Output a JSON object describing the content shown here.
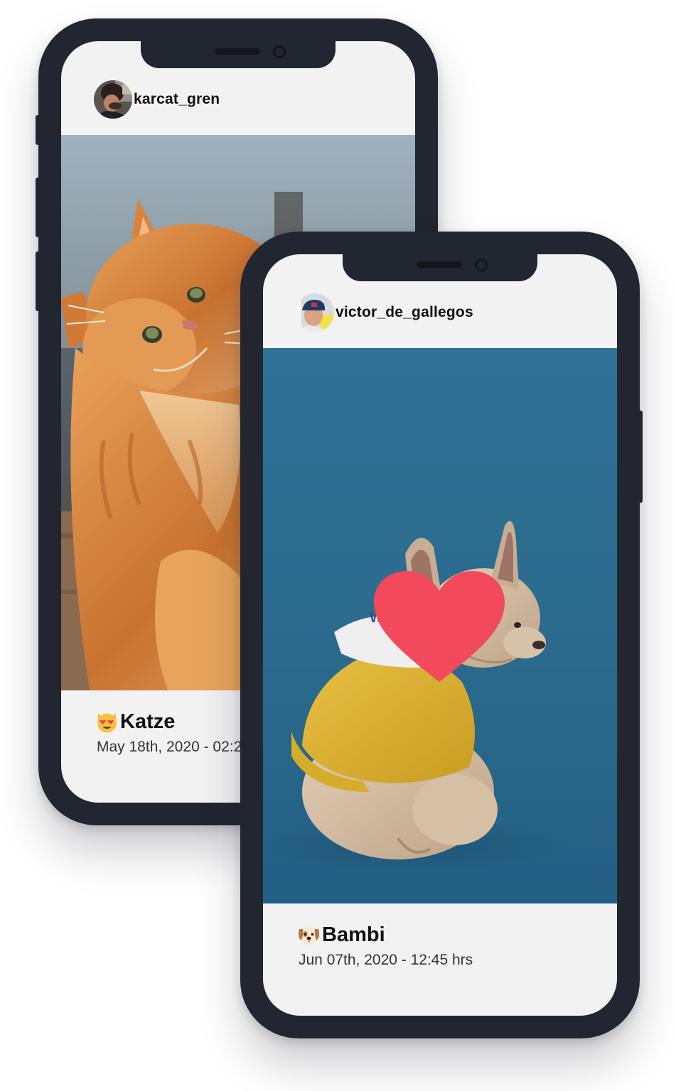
{
  "posts": [
    {
      "username": "karcat_gren",
      "title": "Katze",
      "title_emoji": "heart-eyes-cat-emoji",
      "date": "May 18th, 2020 - 02:25 hrs",
      "photo": "orange-maine-coon-cat"
    },
    {
      "username": "victor_de_gallegos",
      "title": "Bambi",
      "title_emoji": "puppy-face-emoji",
      "date": "Jun 07th, 2020 - 12:45 hrs",
      "photo": "french-bulldog-yellow-hoodie",
      "liked": true,
      "like_icon": "heart-icon"
    }
  ],
  "colors": {
    "phone_frame": "#222630",
    "screen_background": "#f2f2f3",
    "heart": "#f2495c",
    "photo_blue": "#2c6a8e"
  }
}
